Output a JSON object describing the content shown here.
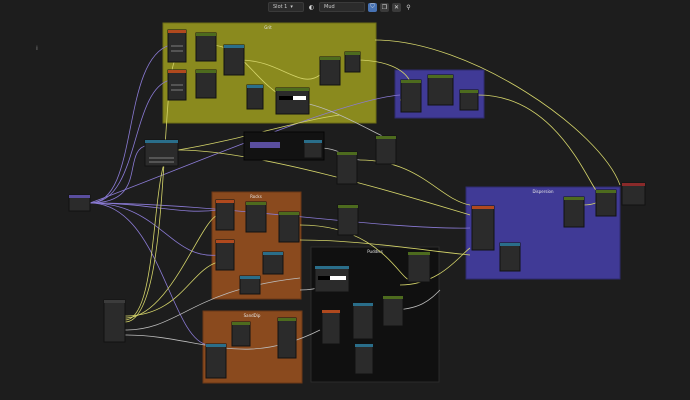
{
  "toolbar": {
    "slot_label": "Slot 1",
    "material_name": "Mud"
  },
  "frames": [
    {
      "label": "Grit"
    },
    {
      "label": "Rocks"
    },
    {
      "label": "SandDip"
    },
    {
      "label": "Puddles"
    },
    {
      "label": "Dispersion"
    }
  ],
  "colors": {
    "background": "#1d1d1d",
    "frame_yellow": "#8a8a1e",
    "frame_blue": "#403a96",
    "frame_orange": "#8a4a1e",
    "frame_dark": "#101010",
    "link_yellow": "#d4d46a",
    "link_purple": "#8a7ad4",
    "link_gray": "#bdbdbd",
    "accent_blue": "#4772b3"
  }
}
